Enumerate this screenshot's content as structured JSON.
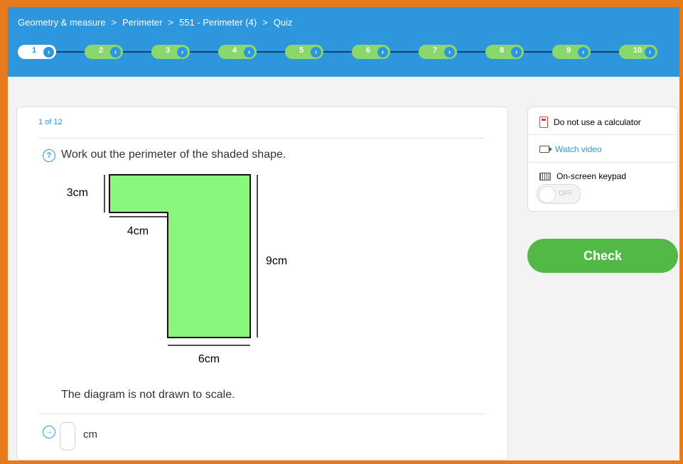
{
  "breadcrumb": {
    "items": [
      "Geometry & measure",
      "Perimeter",
      "551 - Perimeter (4)",
      "Quiz"
    ],
    "separator": ">"
  },
  "steps": [
    "1",
    "2",
    "3",
    "4",
    "5",
    "6",
    "7",
    "8",
    "9",
    "10"
  ],
  "active_step": 1,
  "question": {
    "counter": "1 of 12",
    "text": "Work out the perimeter of the shaded shape.",
    "labels": {
      "top": "3cm",
      "step": "4cm",
      "right": "9cm",
      "bottom": "6cm"
    },
    "note": "The diagram is not drawn to scale.",
    "answer_value": "",
    "unit": "cm"
  },
  "sidebar": {
    "calculator": "Do not use a calculator",
    "video": "Watch video",
    "keypad": "On-screen keypad",
    "keypad_toggle": "OFF"
  },
  "check_label": "Check",
  "colors": {
    "primary": "#2d96dc",
    "frame": "#e87a1e",
    "step_pill": "#8ad86b",
    "shape_fill": "#88f77b",
    "check": "#52b947",
    "danger": "#e03a3a"
  },
  "icons": [
    "help-icon",
    "arrow-right-icon",
    "calculator-icon",
    "video-icon",
    "keyboard-icon",
    "chevron-right-icon"
  ]
}
